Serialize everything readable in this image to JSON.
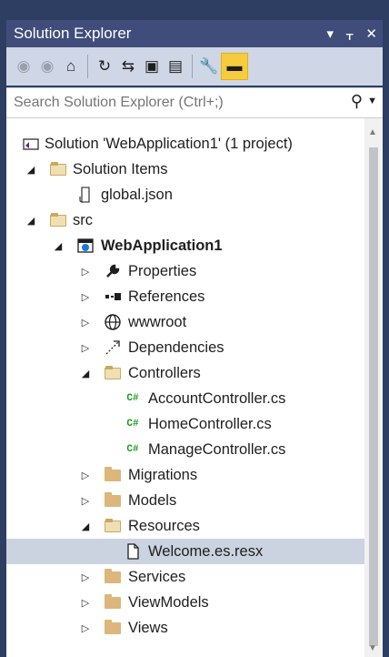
{
  "window": {
    "title": "Solution Explorer",
    "controls": [
      "▾",
      "ᚁ",
      "✕"
    ]
  },
  "toolbar": {
    "icons": [
      "back-icon",
      "forward-icon",
      "home-icon",
      "pending-changes-icon",
      "sync-icon",
      "collapse-all-icon",
      "show-all-files-icon",
      "properties-icon",
      "preview-icon"
    ]
  },
  "search": {
    "placeholder": "Search Solution Explorer (Ctrl+;)",
    "icon": "search-icon"
  },
  "tree": {
    "items": [
      {
        "label": "Solution 'WebApplication1' (1 project)",
        "level": 0,
        "expander": "",
        "icon": "solution-icon"
      },
      {
        "label": "Solution Items",
        "level": 1,
        "expander": "◢",
        "icon": "folder-open-icon"
      },
      {
        "label": "global.json",
        "level": 2,
        "expander": "",
        "icon": "json-file-icon"
      },
      {
        "label": "src",
        "level": 1,
        "expander": "◢",
        "icon": "folder-open-icon"
      },
      {
        "label": "WebApplication1",
        "level": 2,
        "expander": "◢",
        "icon": "web-project-icon",
        "bold": true
      },
      {
        "label": "Properties",
        "level": 3,
        "expander": "▷",
        "icon": "wrench-icon"
      },
      {
        "label": "References",
        "level": 3,
        "expander": "▷",
        "icon": "references-icon"
      },
      {
        "label": "wwwroot",
        "level": 3,
        "expander": "▷",
        "icon": "globe-icon"
      },
      {
        "label": "Dependencies",
        "level": 3,
        "expander": "▷",
        "icon": "dependencies-icon"
      },
      {
        "label": "Controllers",
        "level": 3,
        "expander": "◢",
        "icon": "folder-open-icon"
      },
      {
        "label": "AccountController.cs",
        "level": 4,
        "expander": "",
        "icon": "csharp-icon"
      },
      {
        "label": "HomeController.cs",
        "level": 4,
        "expander": "",
        "icon": "csharp-icon"
      },
      {
        "label": "ManageController.cs",
        "level": 4,
        "expander": "",
        "icon": "csharp-icon"
      },
      {
        "label": "Migrations",
        "level": 3,
        "expander": "▷",
        "icon": "folder-icon"
      },
      {
        "label": "Models",
        "level": 3,
        "expander": "▷",
        "icon": "folder-icon"
      },
      {
        "label": "Resources",
        "level": 3,
        "expander": "◢",
        "icon": "folder-open-icon"
      },
      {
        "label": "Welcome.es.resx",
        "level": 4,
        "expander": "",
        "icon": "resx-file-icon",
        "selected": true
      },
      {
        "label": "Services",
        "level": 3,
        "expander": "▷",
        "icon": "folder-icon"
      },
      {
        "label": "ViewModels",
        "level": 3,
        "expander": "▷",
        "icon": "folder-icon"
      },
      {
        "label": "Views",
        "level": 3,
        "expander": "▷",
        "icon": "folder-icon"
      }
    ]
  },
  "colors": {
    "frame": "#2d3e62",
    "titlebar": "#404d7a",
    "toolbar": "#cfd6e5",
    "selection": "#cbd2e0",
    "active_tool": "#f5cc3c",
    "csharp": "#1e9a1e",
    "folder": "#dcb67a"
  }
}
